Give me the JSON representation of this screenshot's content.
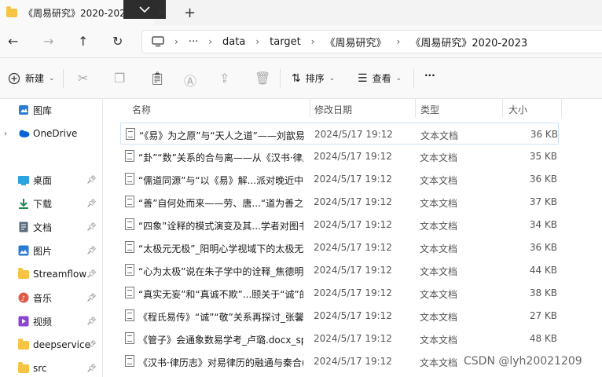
{
  "window": {
    "tab_title": "《周易研究》2020-2023",
    "new_tab_symbol": "+"
  },
  "address": {
    "more": "···",
    "crumbs": [
      "data",
      "target",
      "《周易研究》",
      "《周易研究》2020-2023"
    ]
  },
  "commands": {
    "new_label": "新建",
    "sort_label": "排序",
    "view_label": "查看",
    "more_label": "···"
  },
  "sidebar": {
    "items": [
      {
        "label": "图库",
        "icon": "gallery-icon",
        "color": "#2b7bd1"
      },
      {
        "label": "OneDrive",
        "icon": "cloud-icon",
        "color": "#0a64d6"
      },
      {
        "label": "桌面",
        "icon": "desktop-icon",
        "color": "#2aa3e0"
      },
      {
        "label": "下载",
        "icon": "download-icon",
        "color": "#1d8a4f"
      },
      {
        "label": "文档",
        "icon": "document-icon",
        "color": "#5a6b7d"
      },
      {
        "label": "图片",
        "icon": "picture-icon",
        "color": "#2b7bd1"
      },
      {
        "label": "Streamflow",
        "icon": "folder-icon",
        "color": "#f6c343"
      },
      {
        "label": "音乐",
        "icon": "music-icon",
        "color": "#e05a47"
      },
      {
        "label": "视频",
        "icon": "video-icon",
        "color": "#8a46d1"
      },
      {
        "label": "deepservice",
        "icon": "folder-icon",
        "color": "#f6c343"
      },
      {
        "label": "src",
        "icon": "folder-icon",
        "color": "#f6c343"
      }
    ]
  },
  "columns": {
    "name": "名称",
    "date": "修改日期",
    "type": "类型",
    "size": "大小"
  },
  "files": [
    {
      "name": "“《易》为之原”与“天人之道”——刘歆易...",
      "date": "2024/5/17 19:12",
      "type": "文本文档",
      "size": "36 KB"
    },
    {
      "name": "“卦”“数”关系的合与离——从《汉书·律历...",
      "date": "2024/5/17 19:12",
      "type": "文本文档",
      "size": "35 KB"
    },
    {
      "name": "“儒道同源”与“以《易》解...派对晚近中国...",
      "date": "2024/5/17 19:12",
      "type": "文本文档",
      "size": "36 KB"
    },
    {
      "name": "“善”自何处而来——劳、唐...“道为善之...",
      "date": "2024/5/17 19:12",
      "type": "文本文档",
      "size": "37 KB"
    },
    {
      "name": "“四象”诠释的模式演变及其...学者对图书...",
      "date": "2024/5/17 19:12",
      "type": "文本文档",
      "size": "34 KB"
    },
    {
      "name": "“太极元无极”_阳明心学视域下的太极无...",
      "date": "2024/5/17 19:12",
      "type": "文本文档",
      "size": "36 KB"
    },
    {
      "name": "“心为太极”说在朱子学中的诠释_焦德明....",
      "date": "2024/5/17 19:12",
      "type": "文本文档",
      "size": "44 KB"
    },
    {
      "name": "“真实无妄”和“真诚不欺”...颐关于“诚”的...",
      "date": "2024/5/17 19:12",
      "type": "文本文档",
      "size": "38 KB"
    },
    {
      "name": "《程氏易传》“诚”“敬”关系再探讨_张馨予...",
      "date": "2024/5/17 19:12",
      "type": "文本文档",
      "size": "27 KB"
    },
    {
      "name": "《管子》会通象数易学考_卢璐.docx_spli...",
      "date": "2024/5/17 19:12",
      "type": "文本文档",
      "size": "48 KB"
    },
    {
      "name": "《汉书·律历志》对易律历的融通与秦合(...",
      "date": "2024/5/17 19:12",
      "type": "文本文档",
      "size": ""
    }
  ],
  "watermark": "CSDN @lyh20021209"
}
